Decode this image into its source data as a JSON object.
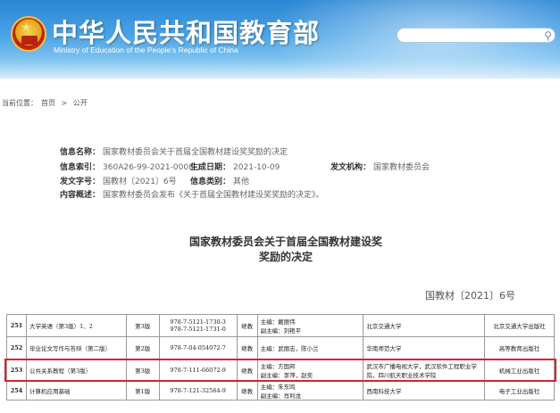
{
  "header": {
    "title": "中华人民共和国教育部",
    "subtitle": "Ministry of Education of the People's Republic of China"
  },
  "breadcrumb": {
    "label": "当前位置：",
    "home": "首页",
    "sep": ">",
    "current": "公开"
  },
  "info": {
    "name_label": "信息名称：",
    "name_value": "国家教材委员会关于首届全国教材建设奖奖励的决定",
    "index_label": "信息索引：",
    "index_value": "360A26-99-2021-0008-1",
    "date_label": "生成日期：",
    "date_value": "2021-10-09",
    "org_label": "发文机构：",
    "org_value": "国家教材委员会",
    "docno_label": "发文字号：",
    "docno_value": "国教材〔2021〕6号",
    "cat_label": "信息类别：",
    "cat_value": "其他",
    "summary_label": "内容概述：",
    "summary_value": "国家教材委员会发布《关于首届全国教材建设奖奖励的决定》。"
  },
  "document": {
    "title_line1": "国家教材委员会关于首届全国教材建设奖",
    "title_line2": "奖励的决定",
    "number": "国教材〔2021〕6号"
  },
  "table": {
    "rows": [
      {
        "no": "251",
        "name": "大学英语（第3版）1、2",
        "edition": "第3版",
        "isbn1": "978-7-5121-1730-3",
        "isbn2": "978-7-5121-1731-0",
        "type": "继教",
        "editor1": "主编：戴丽伟",
        "editor2": "副主编：刘艳平",
        "school": "北京交通大学",
        "press": "北京交通大学出版社"
      },
      {
        "no": "252",
        "name": "毕业论文写作与答辩（第二版）",
        "edition": "第2版",
        "isbn1": "978-7-04-054072-7",
        "isbn2": "",
        "type": "继教",
        "editor1": "主编：武丽志，陈小兰",
        "editor2": "",
        "school": "华南师范大学",
        "press": "高等教育出版社"
      },
      {
        "no": "253",
        "name": "公共关系教程（第3版）",
        "edition": "第3版",
        "isbn1": "978-7-111-66072-9",
        "isbn2": "",
        "type": "继教",
        "editor1": "主编：方国邦",
        "editor2": "副主编：李萍，赵奕",
        "school": "武汉市广播电视大学，武汉软件工程职业学院，四川航天职业技术学院",
        "press": "机械工业出版社"
      },
      {
        "no": "254",
        "name": "计算机应用基础",
        "edition": "第1版",
        "isbn1": "978-7-121-32564-9",
        "isbn2": "",
        "type": "继教",
        "editor1": "主编：朱东鸣",
        "editor2": "副主编：肖利龙",
        "school": "西南科技大学",
        "press": "电子工业出版社"
      }
    ]
  },
  "colors": {
    "banner": "#2a86d4",
    "highlight": "#d9232a"
  },
  "icons": {
    "search": "search-icon",
    "emblem": "national-emblem-icon"
  }
}
